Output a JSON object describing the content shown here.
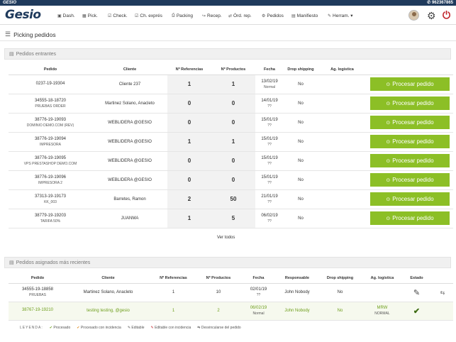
{
  "topbar": {
    "logo": "GESIO",
    "phone": "✆ 962367865"
  },
  "brand": "Gesio",
  "nav": [
    {
      "icon": "▣",
      "label": "Dash."
    },
    {
      "icon": "▦",
      "label": "Pick."
    },
    {
      "icon": "☑",
      "label": "Check."
    },
    {
      "icon": "☑",
      "label": "Ch. exprés"
    },
    {
      "icon": "⎙",
      "label": "Packing"
    },
    {
      "icon": "↪",
      "label": "Recep."
    },
    {
      "icon": "⇄",
      "label": "Órd. rep."
    },
    {
      "icon": "⚙",
      "label": "Pedidos"
    },
    {
      "icon": "▤",
      "label": "Manifiesto"
    },
    {
      "icon": "✎",
      "label": "Herram. ▾"
    }
  ],
  "page_title": "Picking pedidos",
  "incoming": {
    "title": "Pedidos entrantes",
    "headers": [
      "Pedido",
      "Cliente",
      "Nº Referencias",
      "Nº Productos",
      "Fecha",
      "Drop shipping",
      "Ag. logística",
      ""
    ],
    "button_label": "Procesar pedido",
    "rows": [
      {
        "pedido": "0237-19-19304",
        "sub": "",
        "cliente": "Cliente 237",
        "refs": "1",
        "prods": "1",
        "fecha": "13/02/19",
        "fsub": "Normal",
        "drop": "No"
      },
      {
        "pedido": "34555-18-18720",
        "sub": "PRUEBAS ORDER",
        "cliente": "Martinez Solano, Anacleto",
        "refs": "0",
        "prods": "0",
        "fecha": "14/01/19",
        "fsub": "??",
        "drop": "No"
      },
      {
        "pedido": "38776-19-19093",
        "sub": "DOMINIO DEMO.COM (REV)",
        "cliente": "WEBLIDERA @GESIO",
        "refs": "0",
        "prods": "0",
        "fecha": "15/01/19",
        "fsub": "??",
        "drop": "No"
      },
      {
        "pedido": "38776-19-19094",
        "sub": "IMPRESORA",
        "cliente": "WEBLIDERA @GESIO",
        "refs": "1",
        "prods": "1",
        "fecha": "15/01/19",
        "fsub": "??",
        "drop": "No"
      },
      {
        "pedido": "38776-19-19095",
        "sub": "VPS PRESTASHOP DEMO.COM",
        "cliente": "WEBLIDERA @GESIO",
        "refs": "0",
        "prods": "0",
        "fecha": "15/01/19",
        "fsub": "??",
        "drop": "No"
      },
      {
        "pedido": "38776-19-19096",
        "sub": "IMPRESORA 2",
        "cliente": "WEBLIDERA @GESIO",
        "refs": "0",
        "prods": "0",
        "fecha": "15/01/19",
        "fsub": "??",
        "drop": "No"
      },
      {
        "pedido": "37313-19-19173",
        "sub": "KK_003",
        "cliente": "Barretes, Ramon",
        "refs": "2",
        "prods": "50",
        "fecha": "21/01/19",
        "fsub": "??",
        "drop": "No"
      },
      {
        "pedido": "38779-19-19203",
        "sub": "TARIFA 50%",
        "cliente": "JUANMA",
        "refs": "1",
        "prods": "5",
        "fecha": "06/02/19",
        "fsub": "??",
        "drop": "No"
      }
    ],
    "see_all": "Ver todos"
  },
  "assigned": {
    "title": "Pedidos asignados más recientes",
    "headers": [
      "Pedido",
      "Cliente",
      "Nº Referencias",
      "Nº Productos",
      "Fecha",
      "Responsable",
      "Drop shipping",
      "Ag. logística",
      "Estado",
      ""
    ],
    "rows": [
      {
        "pedido": "34555-19-18858",
        "sub": "PRUEBAS",
        "cliente": "Martinez Solano, Anacleto",
        "refs": "1",
        "prods": "10",
        "fecha": "02/01/19",
        "fsub": "??",
        "resp": "John Nobody",
        "drop": "No",
        "ag": "",
        "agsub": "",
        "estado": "pencil-icon"
      },
      {
        "pedido": "38767-19-19210",
        "sub": "",
        "cliente": "testing testing, @gesio",
        "refs": "1",
        "prods": "2",
        "fecha": "06/02/19",
        "fsub": "Normal",
        "resp": "John Nobody",
        "drop": "No",
        "ag": "MRW",
        "agsub": "NORMAL",
        "estado": "check-icon"
      }
    ]
  },
  "legend": {
    "key": "LEYENDA:",
    "items": [
      {
        "icon": "✔",
        "label": "Procesado"
      },
      {
        "icon": "✔",
        "label": "Procesado con incidencia"
      },
      {
        "icon": "✎",
        "label": "Editable"
      },
      {
        "icon": "✎",
        "label": "Editable con incidencia"
      },
      {
        "icon": "⇆",
        "label": "Desvincularse del pedido"
      }
    ]
  },
  "colors": {
    "accent_green": "#8cbf26",
    "topbar": "#1f3a5c",
    "power_red": "#c0262d"
  }
}
